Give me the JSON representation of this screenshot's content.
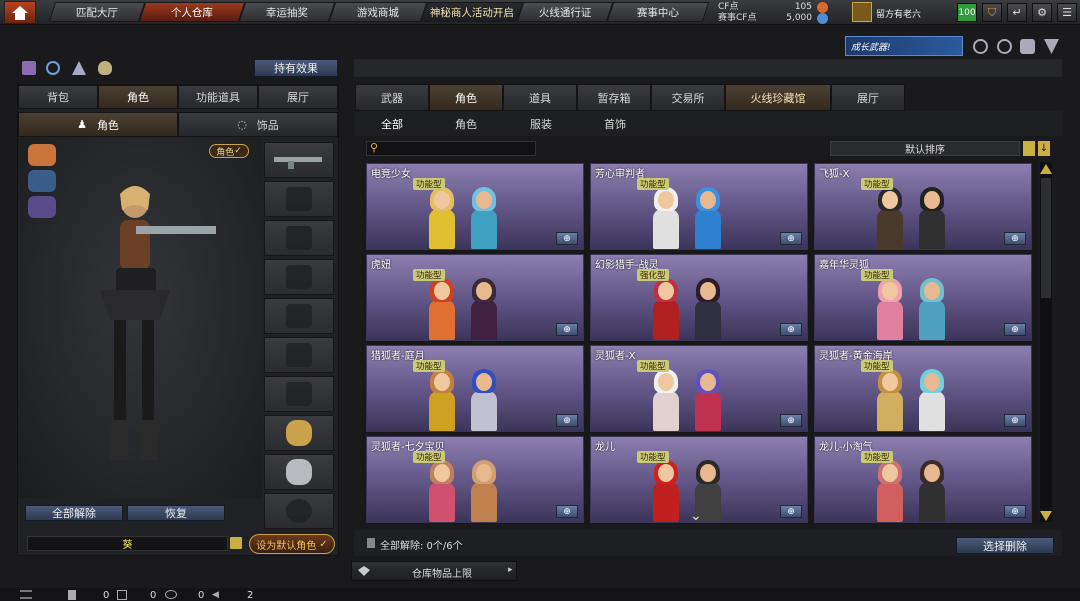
{
  "topnav": {
    "tabs": [
      "匹配大厅",
      "个人仓库",
      "幸运抽奖",
      "游戏商城",
      "神秘商人活动开启",
      "火线通行证",
      "赛事中心"
    ],
    "cf_label": "CF点",
    "cf_value": "105",
    "game_cf_label": "赛事CF点",
    "game_cf_value": "5,000",
    "username": "留方有老六",
    "level": "100"
  },
  "left": {
    "effects_button": "持有效果",
    "tabs": [
      "背包",
      "角色",
      "功能道具",
      "展厅"
    ],
    "subtabs": [
      "角色",
      "饰品"
    ],
    "role_tag": "角色",
    "unequip_all": "全部解除",
    "restore": "恢复",
    "char_name": "葵",
    "set_default": "设为默认角色"
  },
  "right": {
    "banner_text": "成长武器!",
    "tabs": [
      "武器",
      "角色",
      "道具",
      "暂存箱",
      "交易所",
      "火线珍藏馆",
      "展厅"
    ],
    "subtabs": [
      "全部",
      "角色",
      "服装",
      "首饰"
    ],
    "sort_label": "默认排序",
    "search_placeholder": "",
    "cards": [
      {
        "name": "电竞少女",
        "badge": "功能型"
      },
      {
        "name": "芳心审判者",
        "badge": "功能型"
      },
      {
        "name": "飞狐-X",
        "badge": "功能型"
      },
      {
        "name": "虎妞",
        "badge": "功能型"
      },
      {
        "name": "幻影猎手-战灵",
        "badge": "强化型"
      },
      {
        "name": "嘉年华灵狐",
        "badge": "功能型"
      },
      {
        "name": "猎狐者-庭月",
        "badge": "功能型"
      },
      {
        "name": "灵狐者-X",
        "badge": "功能型"
      },
      {
        "name": "灵狐者-黄金海岸",
        "badge": "功能型"
      },
      {
        "name": "灵狐者-七夕宝贝",
        "badge": "功能型"
      },
      {
        "name": "龙儿",
        "badge": "功能型"
      },
      {
        "name": "龙儿-小淘气",
        "badge": "功能型"
      }
    ],
    "unequip_count": "全部解除: 0个/6个",
    "select_delete": "选择删除",
    "storage_limit": "仓库物品上限"
  },
  "statusbar": {
    "values": [
      "0",
      "0",
      "0",
      "2"
    ]
  },
  "colors": {
    "accent": "#b8431f",
    "card_bg": "#6a5e8e",
    "badge": "#c9c97a",
    "button_blue": "#3e4d70",
    "gold_border": "#c9a24a"
  }
}
